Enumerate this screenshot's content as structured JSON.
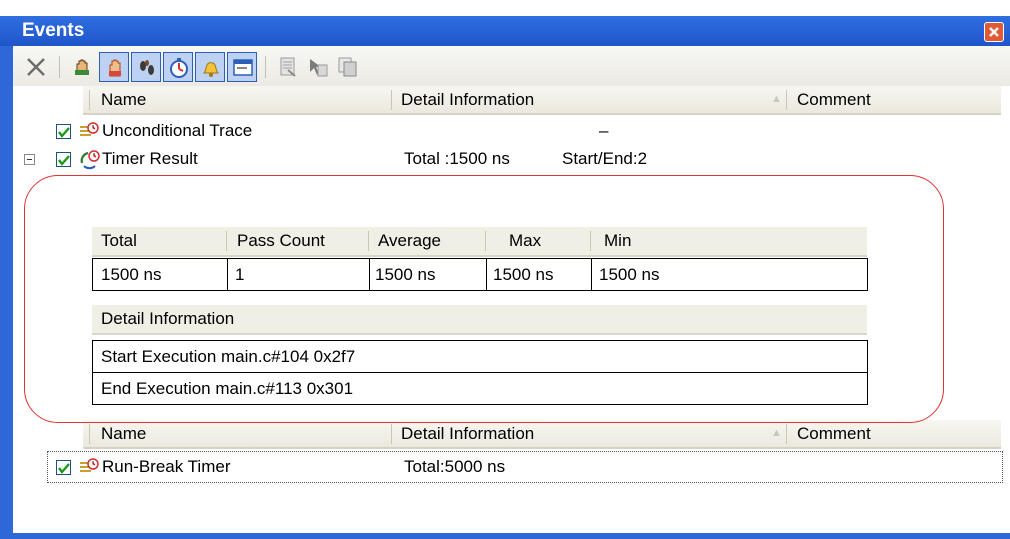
{
  "window": {
    "title": "Events"
  },
  "toolbar": {
    "buttons": [
      {
        "icon": "delete-x-icon",
        "pressed": false
      },
      {
        "icon": "hand-stop-icon",
        "pressed": false
      },
      {
        "icon": "hand-icon",
        "pressed": true
      },
      {
        "icon": "footprints-icon",
        "pressed": true
      },
      {
        "icon": "timer-clock-icon",
        "pressed": true
      },
      {
        "icon": "bell-icon",
        "pressed": true
      },
      {
        "icon": "window-icon",
        "pressed": true
      },
      {
        "icon": "document-icon",
        "pressed": false
      },
      {
        "icon": "cursor-doc-icon",
        "pressed": false
      },
      {
        "icon": "multi-doc-icon",
        "pressed": false
      }
    ]
  },
  "columns": {
    "name": "Name",
    "detail": "Detail Information",
    "comment": "Comment"
  },
  "events": [
    {
      "name": "Unconditional Trace",
      "checked": true,
      "detail": "–",
      "icon": "trace-icon"
    },
    {
      "name": "Timer Result",
      "checked": true,
      "detail_total": "Total :1500 ns",
      "detail_startend": "Start/End:2",
      "icon": "timer-result-icon",
      "expanded": true
    }
  ],
  "timer_table": {
    "headers": [
      "Total",
      "Pass Count",
      "Average",
      "Max",
      "Min"
    ],
    "values": [
      "1500 ns",
      "1",
      "1500 ns",
      "1500 ns",
      "1500 ns"
    ]
  },
  "timer_detail": {
    "header": "Detail Information",
    "rows": [
      "Start Execution main.c#104 0x2f7",
      "End Execution main.c#113 0x301"
    ]
  },
  "events2": [
    {
      "name": "Run-Break Timer",
      "checked": true,
      "detail": "Total:5000 ns",
      "icon": "trace-icon"
    }
  ],
  "colors": {
    "title_bar": "#2f6fe0",
    "highlight": "#e03333",
    "checkbox_check": "#1a9a1a"
  }
}
